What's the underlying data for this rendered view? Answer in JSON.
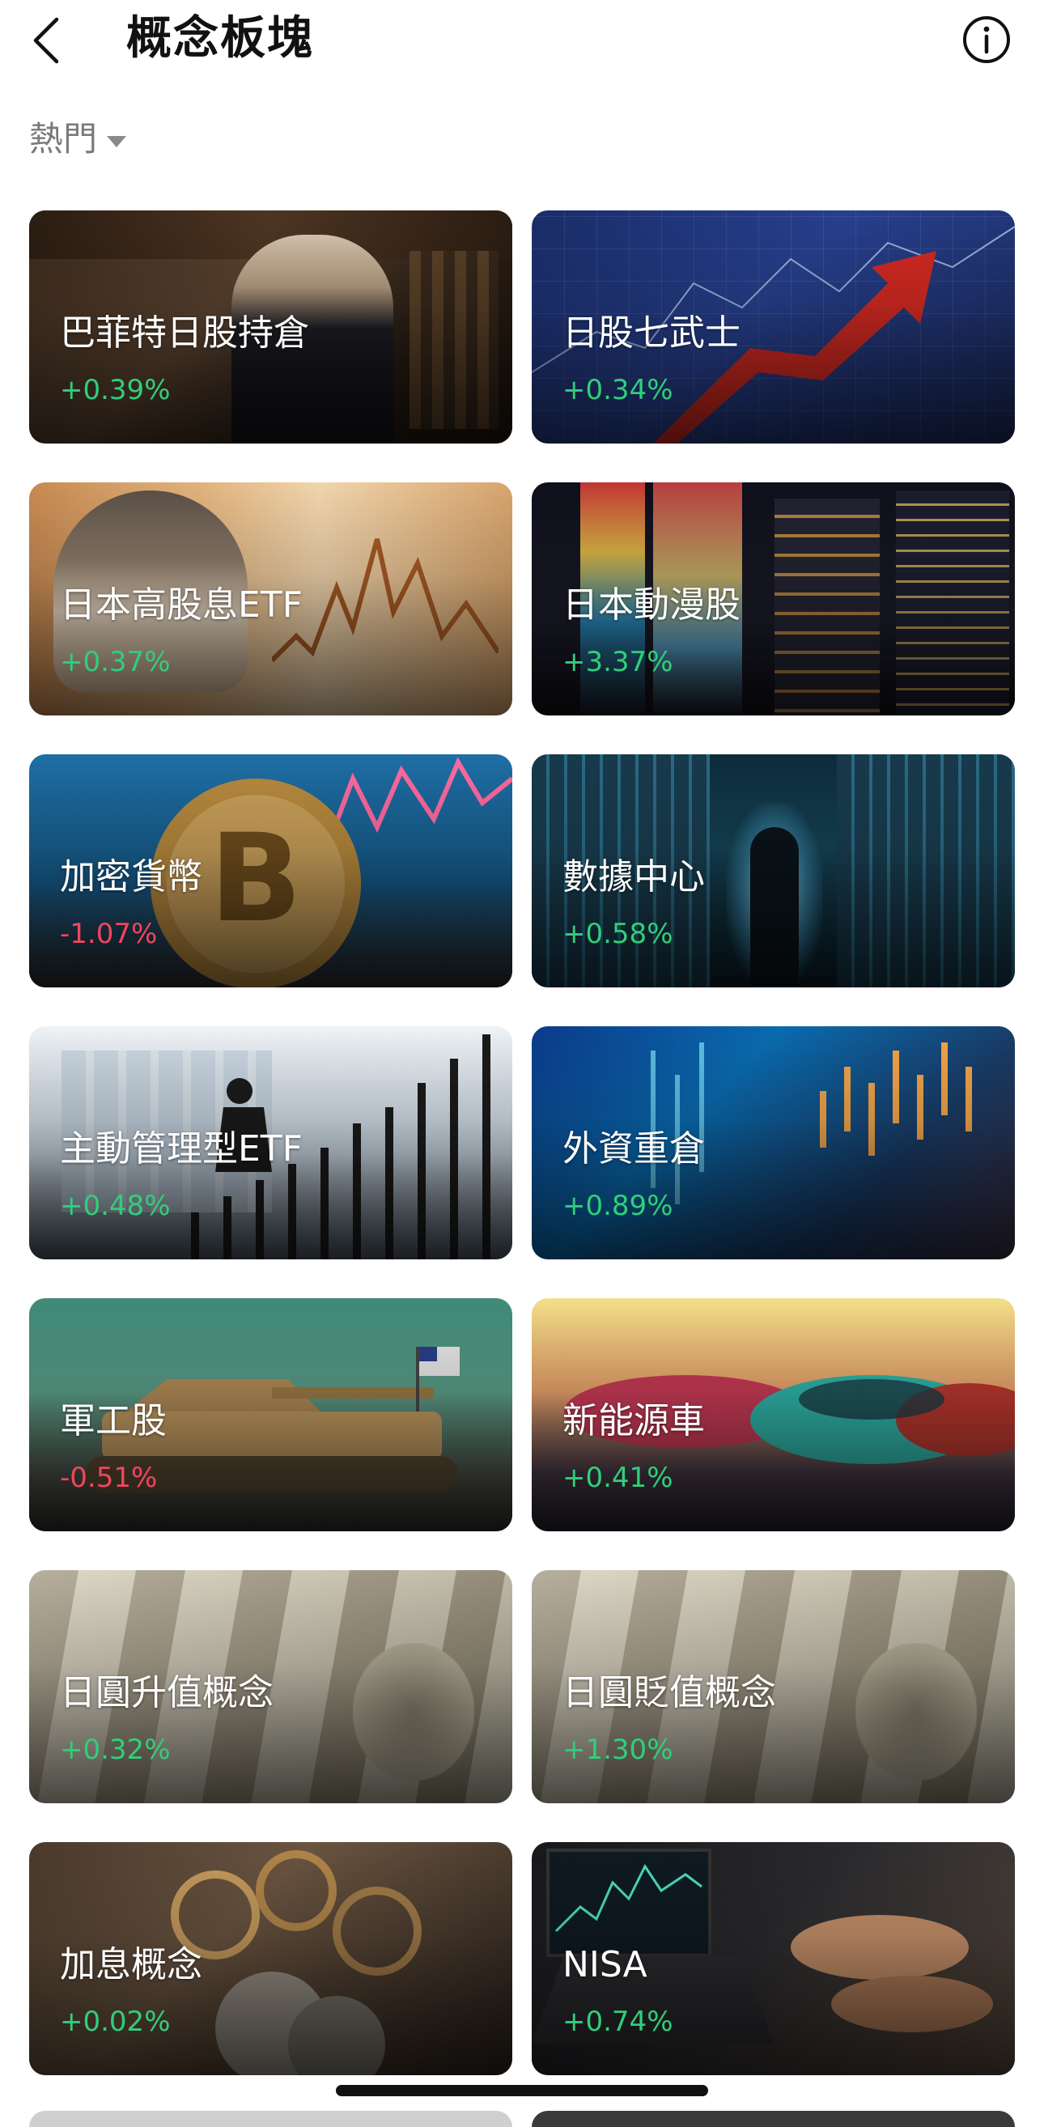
{
  "header": {
    "title": "概念板塊"
  },
  "filter": {
    "label": "熱門"
  },
  "cards": [
    {
      "name": "巴菲特日股持倉",
      "change": "+0.39%",
      "dir": "up"
    },
    {
      "name": "日股七武士",
      "change": "+0.34%",
      "dir": "up"
    },
    {
      "name": "日本高股息ETF",
      "change": "+0.37%",
      "dir": "up"
    },
    {
      "name": "日本動漫股",
      "change": "+3.37%",
      "dir": "up"
    },
    {
      "name": "加密貨幣",
      "change": "-1.07%",
      "dir": "down"
    },
    {
      "name": "數據中心",
      "change": "+0.58%",
      "dir": "up"
    },
    {
      "name": "主動管理型ETF",
      "change": "+0.48%",
      "dir": "up"
    },
    {
      "name": "外資重倉",
      "change": "+0.89%",
      "dir": "up"
    },
    {
      "name": "軍工股",
      "change": "-0.51%",
      "dir": "down"
    },
    {
      "name": "新能源車",
      "change": "+0.41%",
      "dir": "up"
    },
    {
      "name": "日圓升值概念",
      "change": "+0.32%",
      "dir": "up"
    },
    {
      "name": "日圓貶值概念",
      "change": "+1.30%",
      "dir": "up"
    },
    {
      "name": "加息概念",
      "change": "+0.02%",
      "dir": "up"
    },
    {
      "name": "NISA",
      "change": "+0.74%",
      "dir": "up"
    }
  ],
  "colors": {
    "up": "#2fcf7a",
    "down": "#f0455c"
  },
  "icons": {
    "back": "chevron-left-icon",
    "info": "info-circle-icon",
    "filter": "caret-down-icon"
  }
}
